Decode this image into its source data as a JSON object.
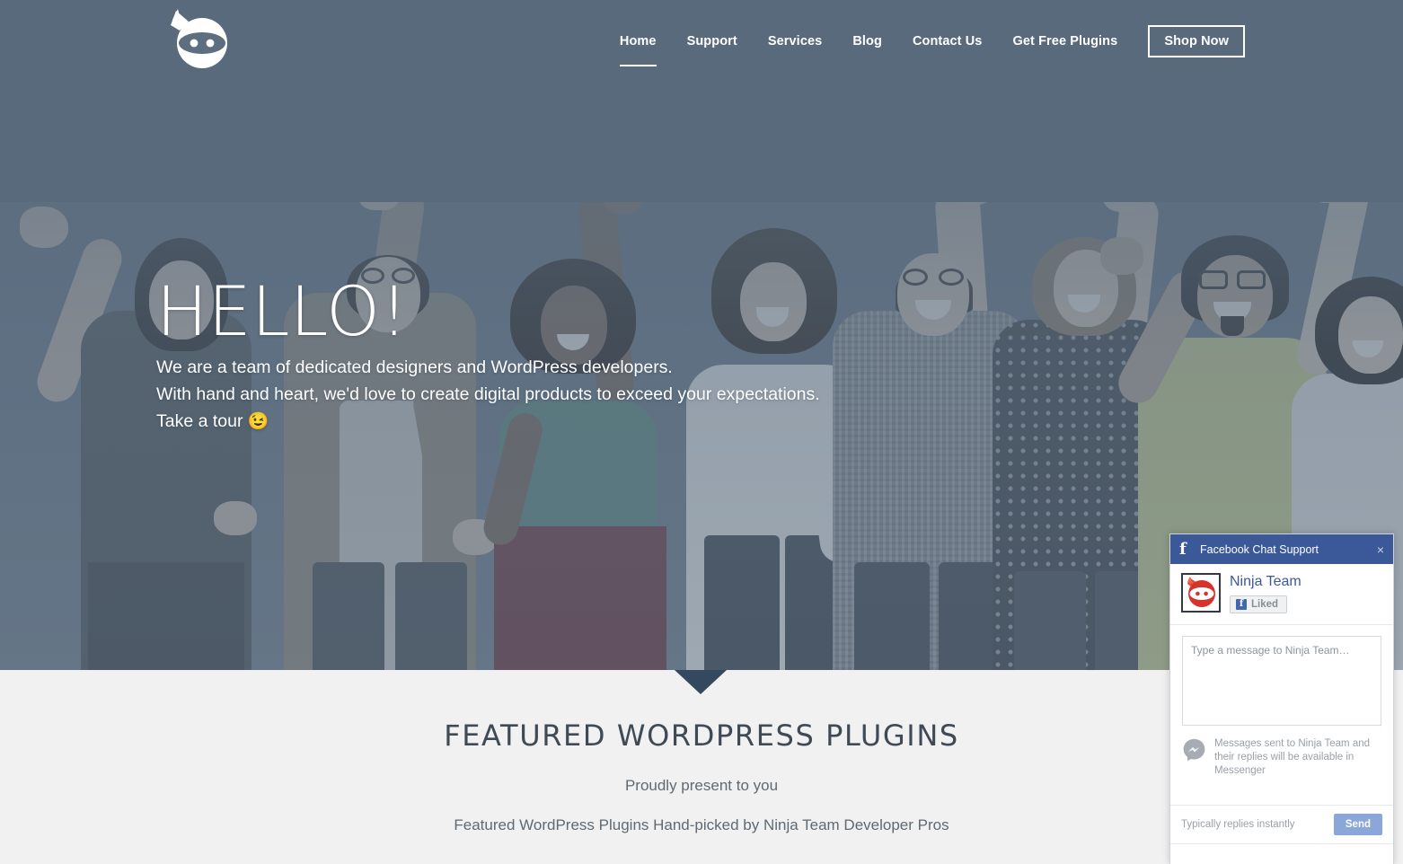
{
  "brand": {
    "logo_alt": "ninja-logo"
  },
  "nav": {
    "items": [
      {
        "label": "Home",
        "active": true
      },
      {
        "label": "Support",
        "active": false
      },
      {
        "label": "Services",
        "active": false
      },
      {
        "label": "Blog",
        "active": false
      },
      {
        "label": "Contact Us",
        "active": false
      },
      {
        "label": "Get Free Plugins",
        "active": false
      }
    ],
    "cta": "Shop Now"
  },
  "hero": {
    "title": "HELLO!",
    "line1": "We are a team of dedicated designers and WordPress developers.",
    "line2": "With hand and heart, we'd love to create digital products to exceed your expectations.",
    "line3": "Take a tour",
    "emoji": "😉"
  },
  "featured": {
    "heading": "FEATURED WORDPRESS PLUGINS",
    "lead": "Proudly present to you",
    "description": "Featured WordPress Plugins Hand-picked by Ninja Team Developer Pros"
  },
  "chat": {
    "header_title": "Facebook Chat Support",
    "close_label": "×",
    "page_name": "Ninja Team",
    "like_label": "Liked",
    "message_placeholder": "Type a message to Ninja Team…",
    "message_value": "",
    "note": "Messages sent to Ninja Team and their replies will be available in Messenger",
    "reply_time": "Typically replies instantly",
    "send_label": "Send"
  },
  "colors": {
    "header_bg": "#586a7c",
    "section_bg": "#f1f1f1",
    "notch": "#35495e",
    "fb_blue": "#3b5998",
    "fb_name_blue": "#3b5998",
    "send_blue": "#8ba6d8",
    "heading_text": "#3f4a55",
    "body_text": "#5f6a72"
  }
}
